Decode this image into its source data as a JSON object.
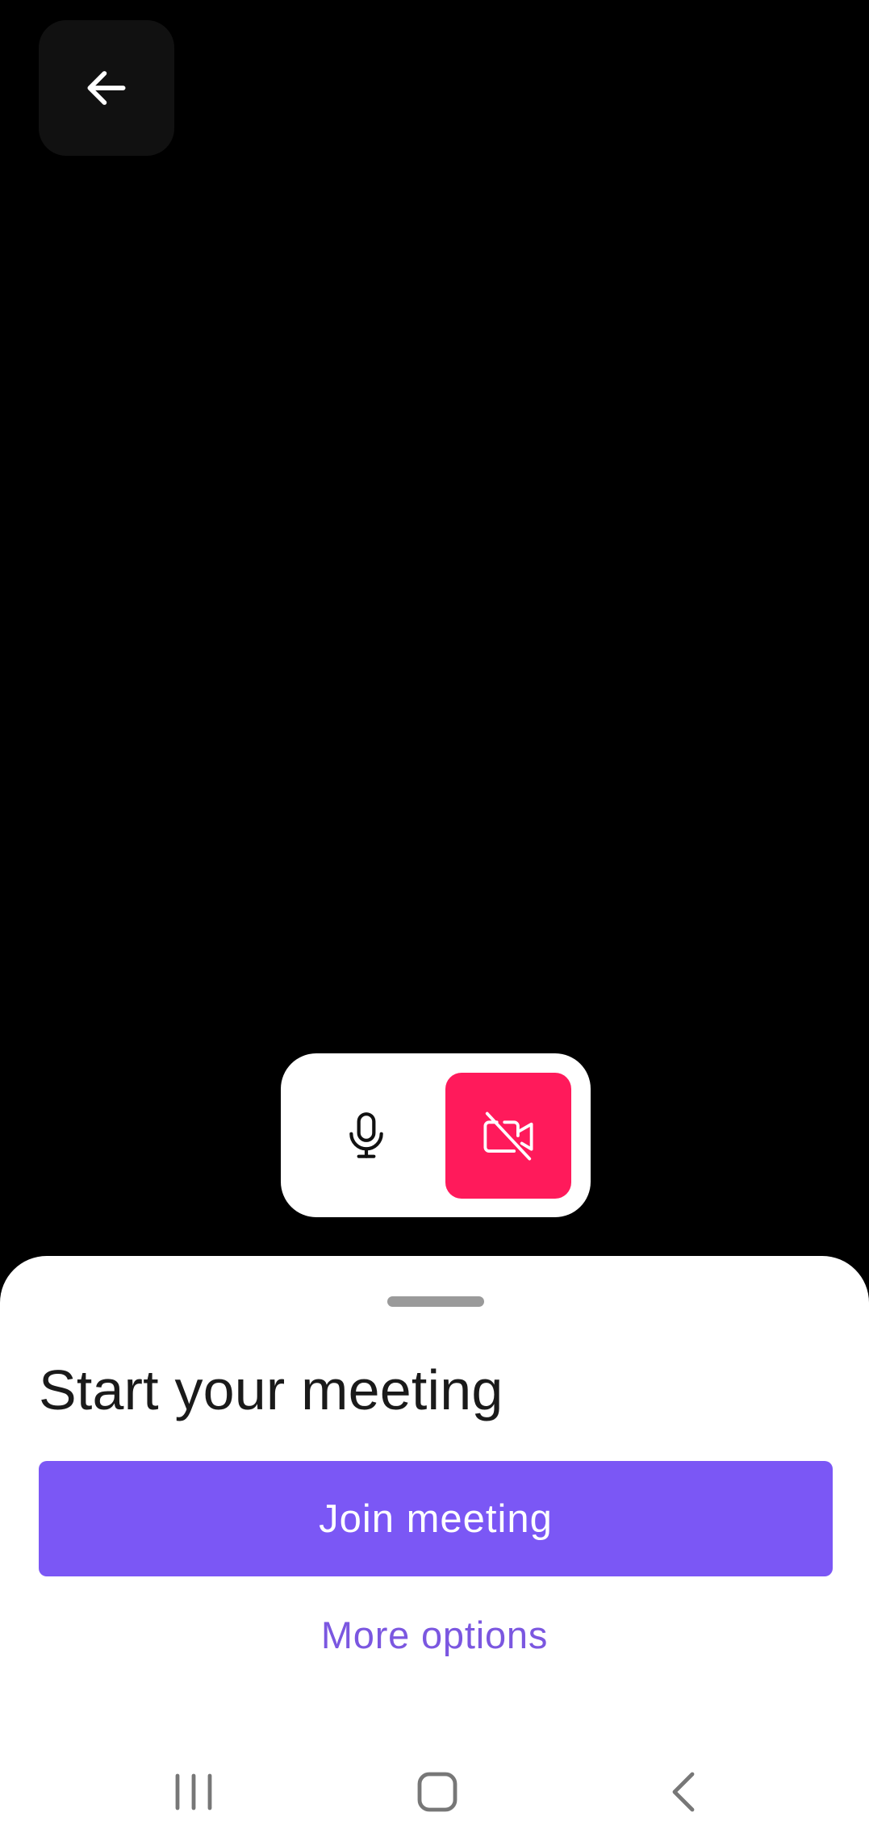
{
  "icons": {
    "back": "arrow-left-icon",
    "mic": "microphone-icon",
    "camera": "camera-off-icon",
    "nav_recent": "recent-apps-icon",
    "nav_home": "home-icon",
    "nav_back": "chevron-left-icon"
  },
  "colors": {
    "background": "#000000",
    "camera_off": "#ff1a5b",
    "accent": "#7b57f5",
    "link": "#7b57e0"
  },
  "sheet": {
    "title": "Start your meeting",
    "join_label": "Join meeting",
    "more_options_label": "More options"
  },
  "media": {
    "mic_on": true,
    "camera_on": false
  }
}
